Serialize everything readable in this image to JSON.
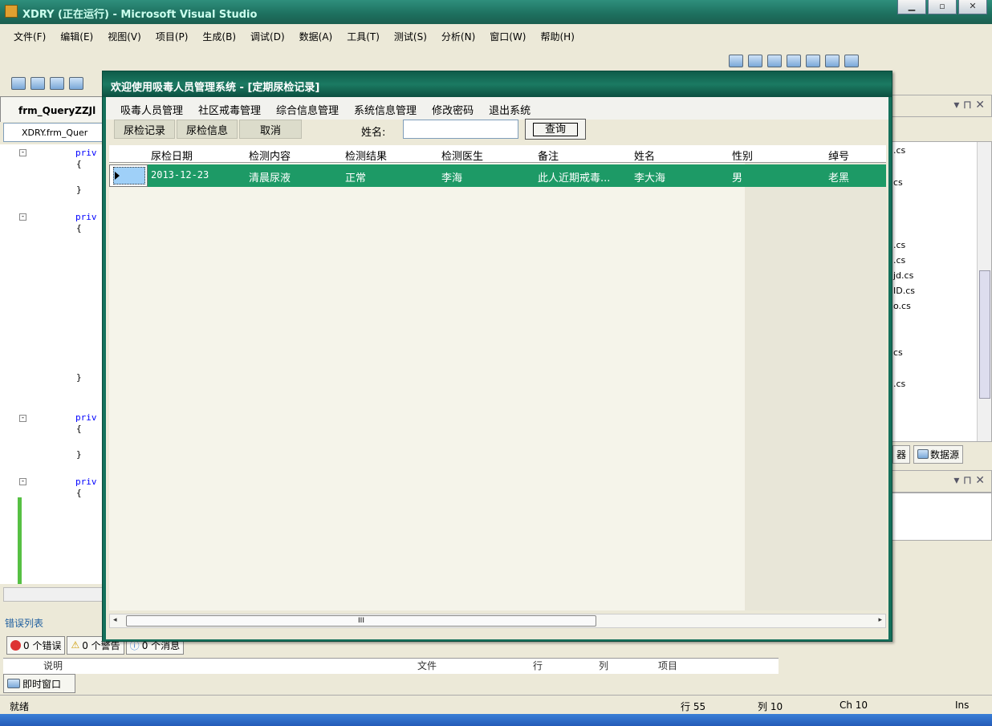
{
  "vs": {
    "title": "XDRY (正在运行) - Microsoft Visual Studio",
    "menu": [
      "文件(F)",
      "编辑(E)",
      "视图(V)",
      "项目(P)",
      "生成(B)",
      "调试(D)",
      "数据(A)",
      "工具(T)",
      "测试(S)",
      "分析(N)",
      "窗口(W)",
      "帮助(H)"
    ],
    "doc_tab": "frm_QueryZZJl",
    "code_combo": "XDRY.frm_Quer",
    "code_keyword": "priv",
    "error_list_title": "错误列表",
    "errors": "0 个错误",
    "warnings": "0 个警告",
    "messages": "0 个消息",
    "err_cols": {
      "desc": "说明",
      "file": "文件",
      "line": "行",
      "col": "列",
      "project": "项目"
    },
    "immediate": "即时窗口",
    "status": {
      "ready": "就绪",
      "line": "行 55",
      "col": "列 10",
      "ch": "Ch 10",
      "ins": "Ins"
    },
    "right_files": [
      ".cs",
      "cs",
      ".cs",
      ".cs",
      "jd.cs",
      "ID.cs",
      "o.cs",
      "cs",
      ".cs"
    ],
    "right_tabs": {
      "a": "器",
      "b": "数据源"
    }
  },
  "app": {
    "title": "欢迎使用吸毒人员管理系统 - [定期尿检记录]",
    "menu": [
      "吸毒人员管理",
      "社区戒毒管理",
      "综合信息管理",
      "系统信息管理",
      "修改密码",
      "退出系统"
    ],
    "toolbar": {
      "btn1": "尿检记录",
      "btn2": "尿检信息",
      "btn3": "取消",
      "name_label": "姓名:",
      "name_value": "",
      "query": "查询"
    },
    "columns": [
      "尿检日期",
      "检测内容",
      "检测结果",
      "检测医生",
      "备注",
      "姓名",
      "性别",
      "绰号"
    ],
    "rows": [
      {
        "date": "2013-12-23",
        "content": "清晨尿液",
        "result": "正常",
        "doctor": "李海",
        "note": "此人近期戒毒...",
        "name": "李大海",
        "sex": "男",
        "nick": "老黑"
      }
    ]
  },
  "colors": {
    "app_frame": "#14705b",
    "selected_row": "#1d9a66",
    "vs_title": "#1d6f5e"
  }
}
